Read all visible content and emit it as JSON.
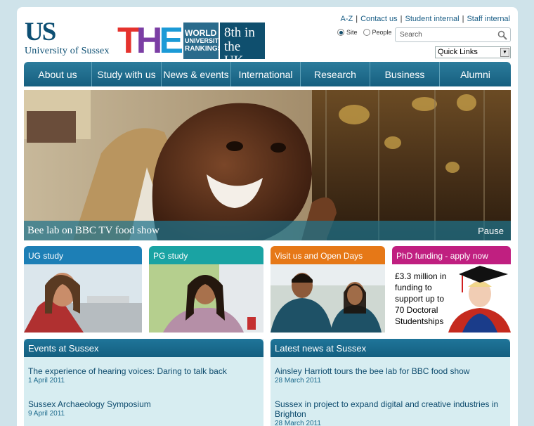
{
  "header": {
    "logo_mark": "US",
    "logo_text": "University of Sussex",
    "the_letters": [
      "T",
      "H",
      "E"
    ],
    "the_wur": [
      "WORLD",
      "UNIVERSITY",
      "RANKINGS"
    ],
    "the_rank": [
      "8th in",
      "the UK"
    ],
    "top_links": [
      "A-Z",
      "Contact us",
      "Student internal",
      "Staff internal"
    ],
    "search_scope": [
      {
        "label": "Site",
        "selected": true
      },
      {
        "label": "People",
        "selected": false
      }
    ],
    "search_placeholder": "Search",
    "quick_links": "Quick Links"
  },
  "nav": [
    "About us",
    "Study with us",
    "News & events",
    "International",
    "Research",
    "Business",
    "Alumni"
  ],
  "hero": {
    "caption": "Bee lab on BBC TV food show",
    "pause_label": "Pause"
  },
  "tiles": [
    {
      "title": "UG study",
      "color": "#1d7fb6"
    },
    {
      "title": "PG study",
      "color": "#1aa3a3"
    },
    {
      "title": "Visit us and Open Days",
      "color": "#e67817"
    },
    {
      "title": "PhD funding - apply now",
      "color": "#c01f80",
      "text": [
        "£3.3 million in",
        "funding to",
        "support up to",
        "70 Doctoral",
        "Studentships"
      ]
    }
  ],
  "events": {
    "heading": "Events at Sussex",
    "items": [
      {
        "title": "The experience of hearing voices: Daring to talk back",
        "date": "1 April 2011"
      },
      {
        "title": "Sussex Archaeology Symposium",
        "date": "9 April 2011"
      }
    ]
  },
  "news": {
    "heading": "Latest news at Sussex",
    "items": [
      {
        "title": "Ainsley Harriott tours the bee lab for BBC food show",
        "date": "28 March 2011"
      },
      {
        "title": "Sussex in project to expand digital and creative industries in Brighton",
        "date": "28 March 2011"
      }
    ]
  }
}
